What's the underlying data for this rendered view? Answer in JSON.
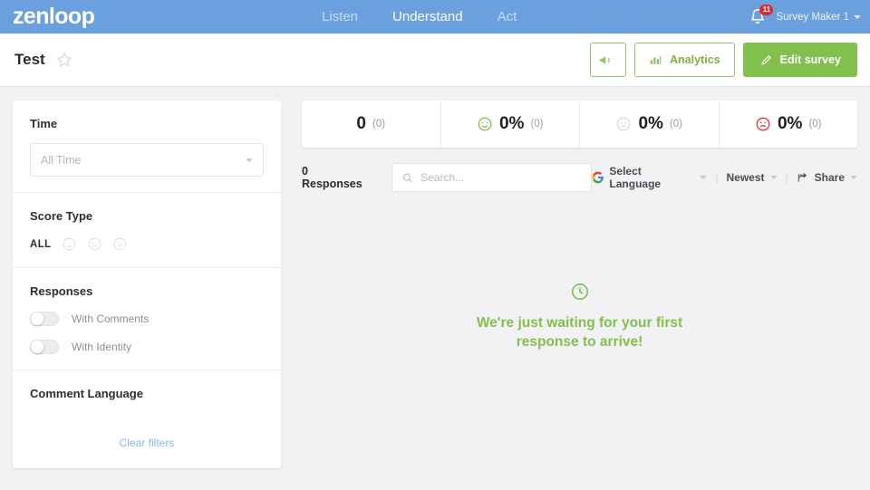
{
  "topbar": {
    "logo": "zenloop",
    "nav": [
      {
        "label": "Listen",
        "active": false
      },
      {
        "label": "Understand",
        "active": true
      },
      {
        "label": "Act",
        "active": false
      }
    ],
    "notification_count": "11",
    "user": "Survey Maker 1",
    "bell_icon": "bell-icon",
    "caret_icon": "chevron-down-icon"
  },
  "subheader": {
    "title": "Test",
    "star_icon": "star-outline-icon",
    "buttons": {
      "announce_label": "",
      "announce_icon": "megaphone-icon",
      "analytics_label": "Analytics",
      "analytics_icon": "bar-chart-icon",
      "edit_label": "Edit survey",
      "edit_icon": "pencil-icon"
    }
  },
  "sidebar": {
    "time": {
      "heading": "Time",
      "select_value": "All Time"
    },
    "score_type": {
      "heading": "Score Type",
      "all_label": "ALL",
      "icons": [
        "smiley-face-icon",
        "neutral-face-icon",
        "sad-face-icon"
      ]
    },
    "responses": {
      "heading": "Responses",
      "toggles": [
        {
          "label": "With Comments",
          "on": false
        },
        {
          "label": "With Identity",
          "on": false
        }
      ]
    },
    "comment_language": {
      "heading": "Comment Language"
    },
    "clear_filters": "Clear filters"
  },
  "kpis": [
    {
      "icon": "none",
      "value": "0",
      "sub": "(0)"
    },
    {
      "icon": "smiley-face-icon",
      "value": "0%",
      "sub": "(0)"
    },
    {
      "icon": "neutral-face-icon",
      "value": "0%",
      "sub": "(0)"
    },
    {
      "icon": "sad-face-icon",
      "value": "0%",
      "sub": "(0)"
    }
  ],
  "toolbar": {
    "responses_label": "0 Responses",
    "search_placeholder": "Search...",
    "search_value": "",
    "search_icon": "search-icon",
    "language_label": "Select Language",
    "language_icon": "google-g-icon",
    "sort_label": "Newest",
    "share_label": "Share",
    "share_icon": "share-icon",
    "separator": "|"
  },
  "empty_state": {
    "icon": "clock-icon",
    "line1": "We're just waiting for your first",
    "line2": "response to arrive!"
  },
  "colors": {
    "header_blue": "#6ba0de",
    "green": "#82c04d",
    "red": "#e8262d",
    "link_blue": "#8ab4e8",
    "page_bg": "#f2f2f4"
  }
}
